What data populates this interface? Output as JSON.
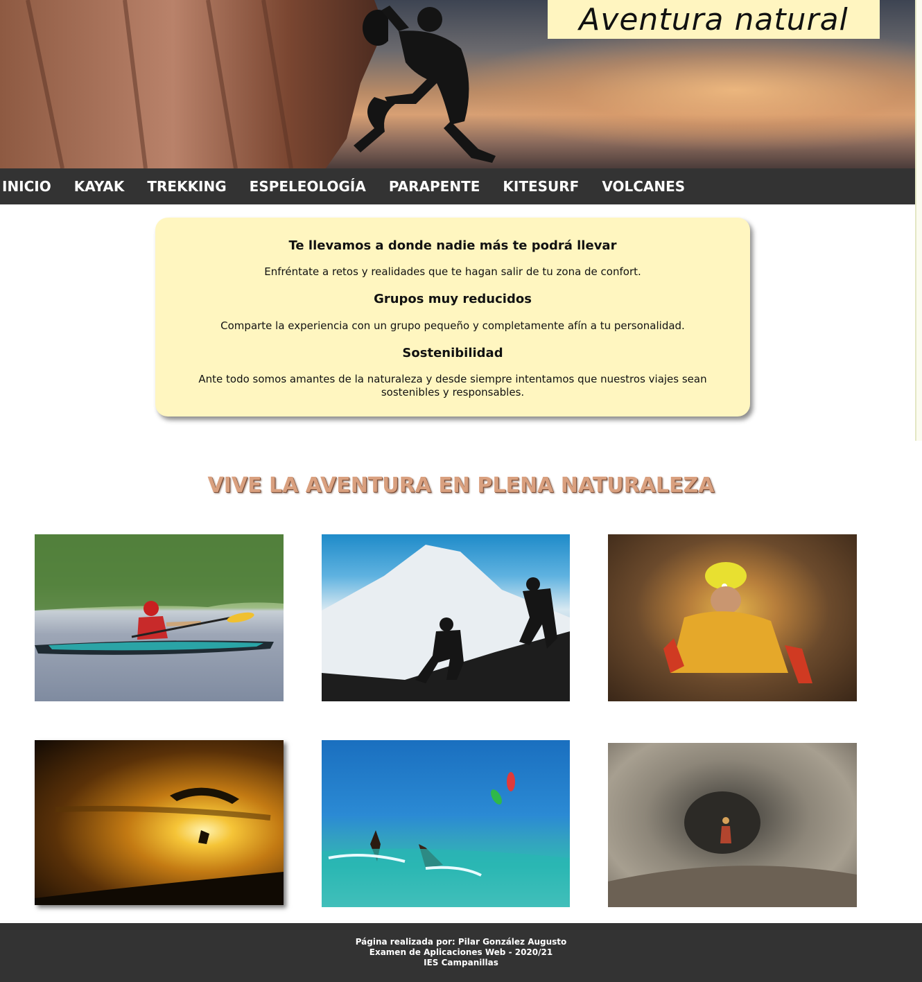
{
  "header": {
    "title": "Aventura natural"
  },
  "nav": {
    "items": [
      "INICIO",
      "KAYAK",
      "TREKKING",
      "ESPELEOLOGÍA",
      "PARAPENTE",
      "KITESURF",
      "VOLCANES"
    ]
  },
  "card": {
    "heading1": "Te llevamos a donde nadie más te podrá llevar",
    "text1": "Enfréntate a retos y realidades que te hagan salir de tu zona de confort.",
    "heading2": "Grupos muy reducidos",
    "text2": "Comparte la experiencia con un grupo pequeño y completamente afín a tu personalidad.",
    "heading3": "Sostenibilidad",
    "text3": "Ante todo somos amantes de la naturaleza y desde siempre intentamos que nuestros viajes sean sostenibles y responsables."
  },
  "section": {
    "title": "VIVE LA AVENTURA EN PLENA NATURALEZA"
  },
  "footer": {
    "line1": "Página realizada por: Pilar González Augusto",
    "line2": "Examen de Aplicaciones Web - 2020/21",
    "line3": "IES Campanillas"
  },
  "colors": {
    "nav_bg": "#333333",
    "card_bg": "#fff6c0",
    "title_box_bg": "#fff5c0",
    "section_title": "#d9a07f",
    "footer_bg": "#333333"
  }
}
